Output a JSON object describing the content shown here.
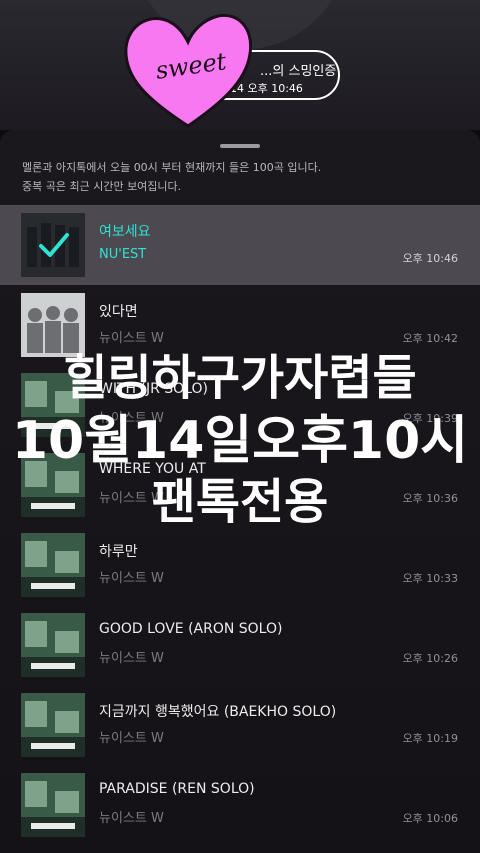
{
  "header": {
    "certification_title": "...의 스밍인증",
    "certification_time": "14 오후 10:46"
  },
  "sticker": {
    "text": "sweet",
    "color": "#f778f0"
  },
  "notice": {
    "line1": "멜론과 아지톡에서 오늘 00시 부터 현재까지 들은 100곡 입니다.",
    "line2": "중복 곡은 최근 시간만 보여집니다."
  },
  "songs": [
    {
      "title": "여보세요",
      "artist": "NU'EST",
      "time": "오후 10:46",
      "selected": true
    },
    {
      "title": "있다면",
      "artist": "뉴이스트 W",
      "time": "오후 10:42"
    },
    {
      "title": "WITH (JR SOLO)",
      "artist": "뉴이스트 W",
      "time": "오후 10:39"
    },
    {
      "title": "WHERE YOU AT",
      "artist": "뉴이스트 W",
      "time": "오후 10:36"
    },
    {
      "title": "하루만",
      "artist": "뉴이스트 W",
      "time": "오후 10:33"
    },
    {
      "title": "GOOD LOVE (ARON SOLO)",
      "artist": "뉴이스트 W",
      "time": "오후 10:26"
    },
    {
      "title": "지금까지 행복했어요 (BAEKHO SOLO)",
      "artist": "뉴이스트 W",
      "time": "오후 10:19"
    },
    {
      "title": "PARADISE (REN SOLO)",
      "artist": "뉴이스트 W",
      "time": "오후 10:06"
    }
  ],
  "overlay": {
    "line1": "힐링하구가자렵들",
    "line2": "10월14일오후10시",
    "line3": "팬톡전용"
  },
  "colors": {
    "accent": "#2fe2d2",
    "selected_row": "#4c4a50",
    "background": "#141216"
  }
}
